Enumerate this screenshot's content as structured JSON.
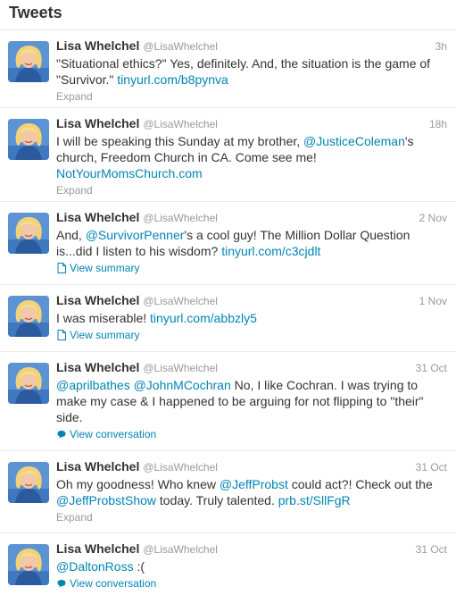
{
  "header": {
    "title": "Tweets"
  },
  "colors": {
    "link": "#0084b4",
    "muted": "#999999",
    "text": "#333333"
  },
  "tweets": [
    {
      "name": "Lisa Whelchel",
      "handle": "@LisaWhelchel",
      "time": "3h",
      "parts": [
        {
          "t": "\"Situational ethics?\" Yes, definitely. And, the situation is the game of \"Survivor.\" "
        },
        {
          "l": "tinyurl.com/b8pynva"
        }
      ],
      "action": "Expand",
      "action_icon": ""
    },
    {
      "name": "Lisa Whelchel",
      "handle": "@LisaWhelchel",
      "time": "18h",
      "parts": [
        {
          "t": "I will be speaking this Sunday at my brother, "
        },
        {
          "l": "@JusticeColeman"
        },
        {
          "t": "'s church, Freedom Church in CA. Come see me! "
        },
        {
          "l": "NotYourMomsChurch.com"
        }
      ],
      "action": "Expand",
      "action_icon": ""
    },
    {
      "name": "Lisa Whelchel",
      "handle": "@LisaWhelchel",
      "time": "2 Nov",
      "parts": [
        {
          "t": "And, "
        },
        {
          "l": "@SurvivorPenner"
        },
        {
          "t": "'s a cool guy! The Million Dollar Question is...did I listen to his wisdom? "
        },
        {
          "l": "tinyurl.com/c3cjdlt"
        }
      ],
      "action": "View summary",
      "action_icon": "summary-icon"
    },
    {
      "name": "Lisa Whelchel",
      "handle": "@LisaWhelchel",
      "time": "1 Nov",
      "parts": [
        {
          "t": "I was miserable! "
        },
        {
          "l": "tinyurl.com/abbzly5"
        }
      ],
      "action": "View summary",
      "action_icon": "summary-icon"
    },
    {
      "name": "Lisa Whelchel",
      "handle": "@LisaWhelchel",
      "time": "31 Oct",
      "parts": [
        {
          "l": "@aprilbathes"
        },
        {
          "t": " "
        },
        {
          "l": "@JohnMCochran"
        },
        {
          "t": " No, I like Cochran. I was trying to make my case & I happened to be arguing for not flipping to \"their\" side."
        }
      ],
      "action": "View conversation",
      "action_icon": "conversation-icon"
    },
    {
      "name": "Lisa Whelchel",
      "handle": "@LisaWhelchel",
      "time": "31 Oct",
      "parts": [
        {
          "t": "Oh my goodness! Who knew "
        },
        {
          "l": "@JeffProbst"
        },
        {
          "t": " could act?! Check out the "
        },
        {
          "l": "@JeffProbstShow"
        },
        {
          "t": " today. Truly talented. "
        },
        {
          "l": "prb.st/SllFgR"
        }
      ],
      "action": "Expand",
      "action_icon": ""
    },
    {
      "name": "Lisa Whelchel",
      "handle": "@LisaWhelchel",
      "time": "31 Oct",
      "parts": [
        {
          "l": "@DaltonRoss"
        },
        {
          "t": " :("
        }
      ],
      "action": "View conversation",
      "action_icon": "conversation-icon"
    }
  ]
}
